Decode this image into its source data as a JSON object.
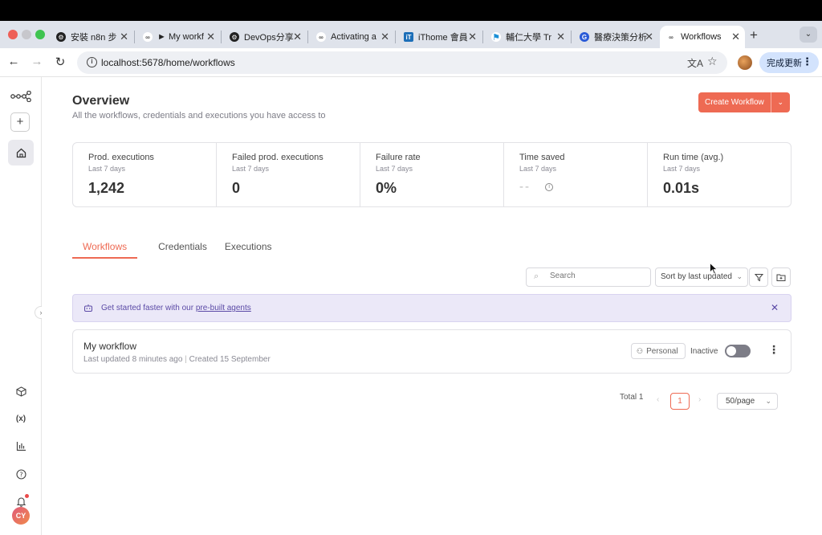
{
  "browser": {
    "tabs": [
      {
        "title": "安裝 n8n 步",
        "icon": "openai-icon"
      },
      {
        "title": "► My workf",
        "icon": "n8n-icon"
      },
      {
        "title": "DevOps分享",
        "icon": "openai-icon"
      },
      {
        "title": "Activating a",
        "icon": "n8n-icon"
      },
      {
        "title": "iThome 會員",
        "icon": "ithome-icon"
      },
      {
        "title": "輔仁大學 Tr",
        "icon": "fju-icon"
      },
      {
        "title": "醫療決策分析",
        "icon": "google-icon"
      },
      {
        "title": "Workflows",
        "icon": "n8n-icon"
      }
    ],
    "url": "localhost:5678/home/workflows",
    "update_label": "完成更新"
  },
  "overview": {
    "title": "Overview",
    "subtitle": "All the workflows, credentials and executions you have access to",
    "create_label": "Create Workflow"
  },
  "stats": [
    {
      "title": "Prod. executions",
      "period": "Last 7 days",
      "value": "1,242"
    },
    {
      "title": "Failed prod. executions",
      "period": "Last 7 days",
      "value": "0"
    },
    {
      "title": "Failure rate",
      "period": "Last 7 days",
      "value": "0%"
    },
    {
      "title": "Time saved",
      "period": "Last 7 days",
      "value": "--"
    },
    {
      "title": "Run time (avg.)",
      "period": "Last 7 days",
      "value": "0.01s"
    }
  ],
  "tabs": [
    "Workflows",
    "Credentials",
    "Executions"
  ],
  "filters": {
    "search_placeholder": "Search",
    "sort_label": "Sort by last updated"
  },
  "banner": {
    "text": "Get started faster with our",
    "link": "pre-built agents"
  },
  "workflows": [
    {
      "name": "My workflow",
      "updated": "Last updated 8 minutes ago",
      "created": "Created 15 September",
      "owner": "Personal",
      "status": "Inactive"
    }
  ],
  "pagination": {
    "total": "Total 1",
    "page": "1",
    "page_size": "50/page"
  },
  "user": {
    "initials": "CY"
  },
  "colors": {
    "accent": "#ee6a53",
    "banner_bg": "#ebe8f8",
    "banner_text": "#5b4aa6"
  }
}
